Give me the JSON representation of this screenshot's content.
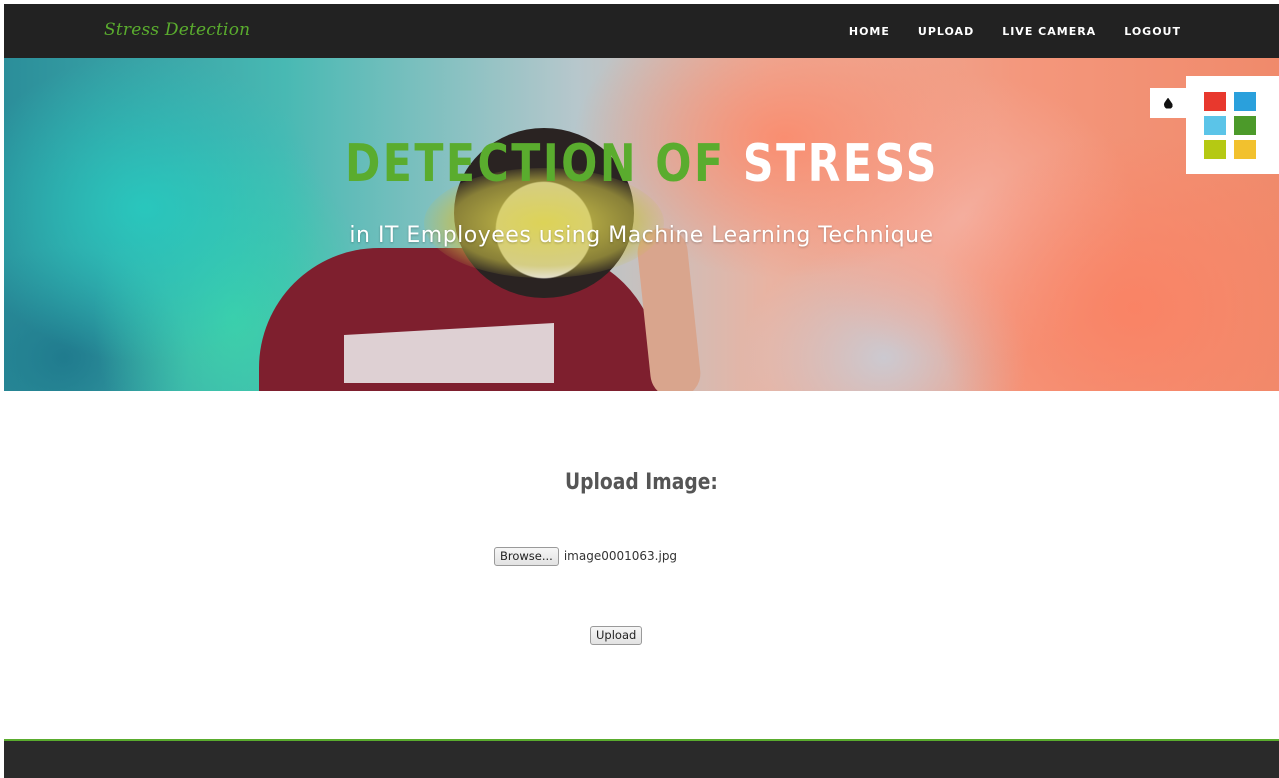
{
  "navbar": {
    "brand": "Stress Detection",
    "links": [
      "HOME",
      "UPLOAD",
      "LIVE CAMERA",
      "LOGOUT"
    ]
  },
  "hero": {
    "title_green": "DETECTION OF",
    "title_white": "STRESS",
    "subtitle": "in IT Employees using Machine Learning Technique"
  },
  "style_switcher": {
    "toggle_icon": "drop-icon",
    "swatches": [
      "#e8382d",
      "#2aa0dc",
      "#5bc4e8",
      "#4c9a2a",
      "#b5c913",
      "#f2c12e"
    ]
  },
  "upload": {
    "heading": "Upload Image:",
    "browse_label": "Browse...",
    "file_name": "image0001063.jpg",
    "upload_label": "Upload"
  },
  "colors": {
    "accent": "#5aac2e",
    "navbar_bg": "#222222",
    "footer_bg": "#2a2a2a"
  }
}
